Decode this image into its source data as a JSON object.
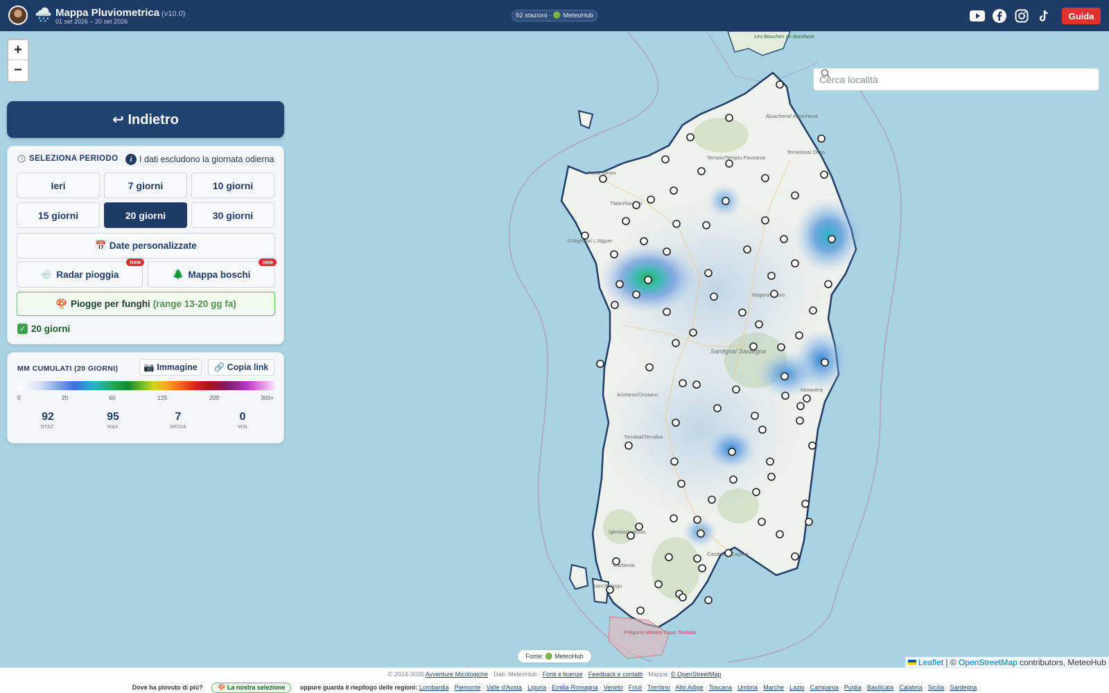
{
  "header": {
    "app_icon": "🌧️",
    "title": "Mappa Pluviometrica",
    "version": "(v10.0)",
    "date_range": "01 set 2026 – 20 set 2026",
    "stations_pill": "92 stazioni · 🟢 MeteoHub",
    "guide_label": "Guida",
    "social_icons": [
      "youtube-icon",
      "facebook-icon",
      "instagram-icon",
      "tiktok-icon"
    ]
  },
  "map": {
    "zoom_in": "+",
    "zoom_out": "−",
    "search_placeholder": "Cerca località",
    "source_label": "Fonte: 🟢 MeteoHub",
    "attribution": {
      "leaflet": "Leaflet",
      "separator": " | © ",
      "osm": "OpenStreetMap",
      "rest": " contributors, MeteoHub"
    },
    "labels": [
      "Les Bouches de Bonifacio",
      "Alzachena/ Arzachena",
      "Tempio/Tempiu Pausania",
      "Porto Torres",
      "Tàtari/Sassari",
      "Terranova/ Olbia",
      "S'Alighera/ L'Alguer",
      "Sardigna/ Sardegna",
      "Aristanis/Oristano",
      "Terrabal/Terralba",
      "Iglesias/Igrèsias",
      "Carbonia",
      "Casteddu/Cagliari",
      "Poligono Militare Capo Teulada",
      "Nùgoro/Nuoro",
      "Sant'Antiogu",
      "Muravera"
    ]
  },
  "panel": {
    "back_label": "↩ Indietro",
    "period_heading": "SELEZIONA PERIODO",
    "period_note": "I dati escludono la giornata odierna",
    "periods": [
      "Ieri",
      "7 giorni",
      "10 giorni",
      "15 giorni",
      "20 giorni",
      "30 giorni"
    ],
    "active_period": "20 giorni",
    "custom_dates": "📅 Date personalizzate",
    "radar_label": "Radar pioggia",
    "woods_label": "Mappa boschi",
    "new_badge": "new",
    "fungi_label": "Piogge per funghi",
    "fungi_range": "(range 13-20 gg fa)",
    "selected_label": "20 giorni"
  },
  "legend": {
    "title": "MM CUMULATI (20 GIORNI)",
    "image_button": "📷 Immagine",
    "link_button": "🔗 Copia link",
    "ticks": [
      "0",
      "20",
      "60",
      "125",
      "200",
      "300+"
    ],
    "stats": [
      {
        "value": "92",
        "label": "STAZ."
      },
      {
        "value": "95",
        "label": "MAX"
      },
      {
        "value": "7",
        "label": "MEDIA"
      },
      {
        "value": "0",
        "label": "MIN"
      }
    ]
  },
  "footer": {
    "line1_prefix": "© 2024-2026",
    "line1_link1": "Avventure Micologiche",
    "line1_mid": " · Dati: MeteoHub · ",
    "line1_link2": "Fonti e licenze",
    "line1_sep": " · ",
    "line1_link3": "Feedback e contatti",
    "line1_map": " · Mappa: ",
    "line1_link4": "© OpenStreetMap",
    "question": "Dove ha piovuto di più?",
    "selection_pill": "🍄 La nostra selezione",
    "regions_intro": "oppure guarda il riepilogo delle regioni:",
    "regions": [
      "Lombardia",
      "Piemonte",
      "Valle d'Aosta",
      "Liguria",
      "Emilia-Romagna",
      "Veneto",
      "Friuli",
      "Trentino",
      "Alto Adige",
      "Toscana",
      "Umbria",
      "Marche",
      "Lazio",
      "Campania",
      "Puglia",
      "Basilicata",
      "Calabria",
      "Sicilia",
      "Sardegna"
    ]
  }
}
